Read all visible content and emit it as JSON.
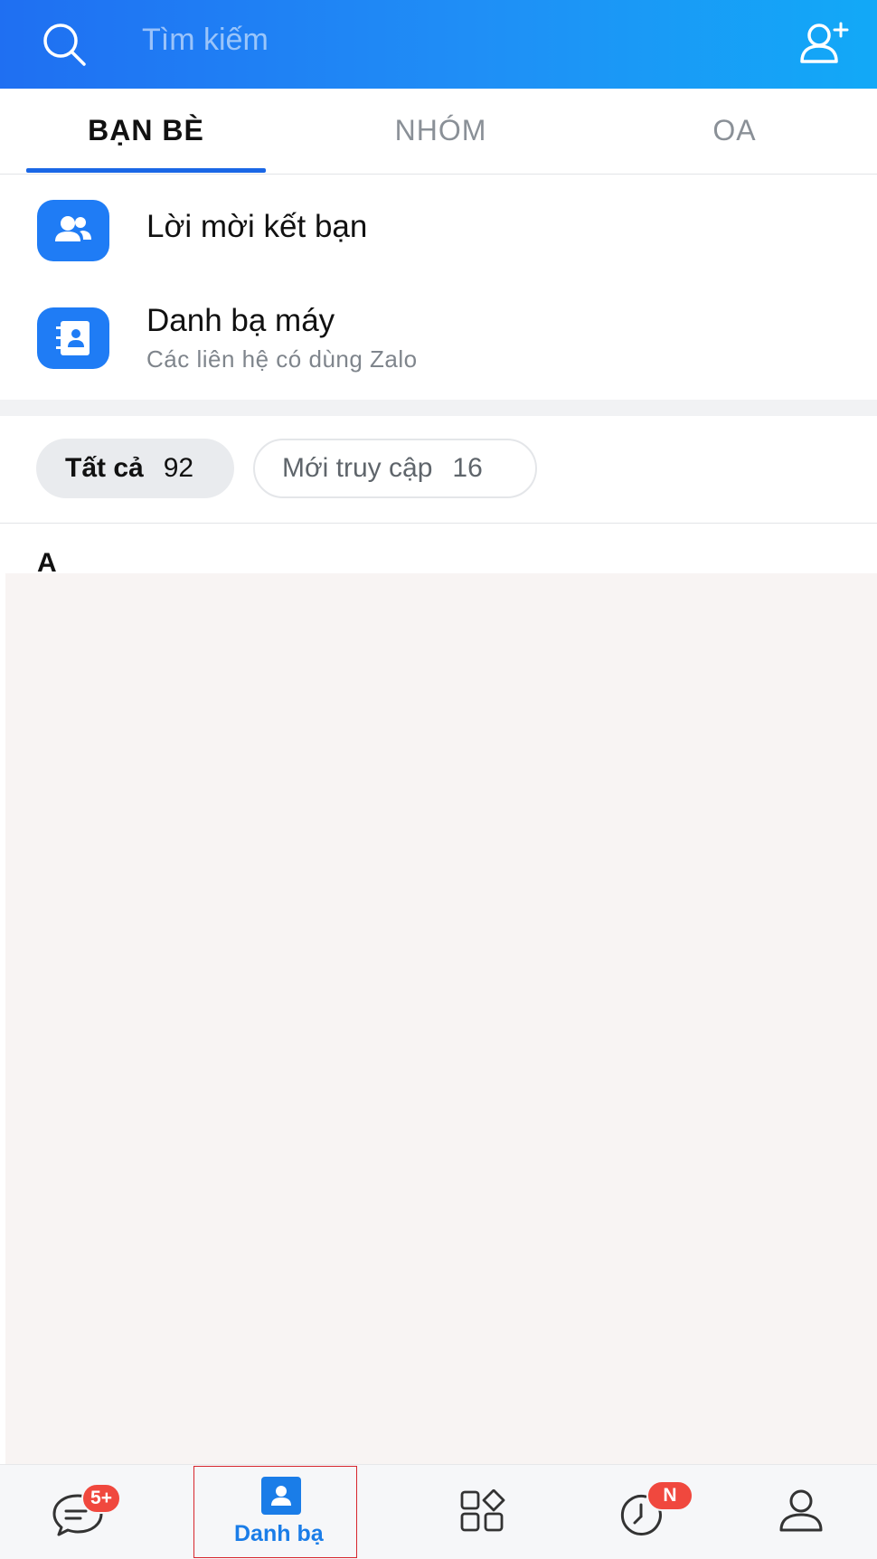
{
  "header": {
    "search_placeholder": "Tìm kiếm",
    "search_icon": "search-icon",
    "add_friend_icon": "add-friend-icon",
    "gradient_colors": [
      "#1f6ff2",
      "#12a9f7"
    ]
  },
  "tabs": [
    {
      "label": "BẠN BÈ",
      "active": true
    },
    {
      "label": "NHÓM",
      "active": false
    },
    {
      "label": "OA",
      "active": false
    }
  ],
  "rows": {
    "friend_requests": {
      "title": "Lời mời kết bạn",
      "icon": "users-icon"
    },
    "phone_contacts": {
      "title": "Danh bạ máy",
      "subtitle": "Các liên hệ có dùng Zalo",
      "icon": "contact-book-icon"
    }
  },
  "filters": {
    "all": {
      "label": "Tất cả",
      "count": "92",
      "active": true
    },
    "recent": {
      "label": "Mới truy cập",
      "count": "16",
      "active": false
    }
  },
  "list": {
    "section_letter": "A"
  },
  "bottom_nav": {
    "messages": {
      "icon": "chat-icon",
      "badge": "5+"
    },
    "contacts": {
      "icon": "contacts-icon",
      "label": "Danh bạ",
      "active": true
    },
    "discover": {
      "icon": "apps-grid-icon"
    },
    "timeline": {
      "icon": "clock-icon",
      "badge": "N"
    },
    "profile": {
      "icon": "user-icon"
    }
  },
  "colors": {
    "accent": "#1a67e6",
    "icon_blue": "#1f7cf5",
    "badge_red": "#f0483e",
    "highlight_red": "#d7252d"
  }
}
